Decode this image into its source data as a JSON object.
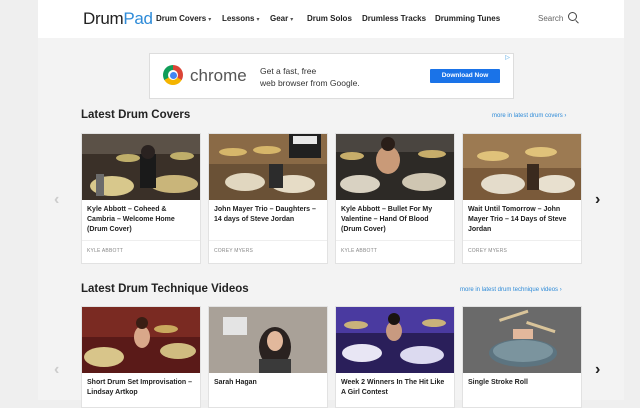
{
  "header": {
    "logo_drum": "Drum",
    "logo_pad": "Pad",
    "nav": [
      {
        "label": "Drum Covers",
        "has_dropdown": true
      },
      {
        "label": "Lessons",
        "has_dropdown": true
      },
      {
        "label": "Gear",
        "has_dropdown": true
      },
      {
        "label": "Drum Solos",
        "has_dropdown": false
      },
      {
        "label": "Drumless Tracks",
        "has_dropdown": false
      },
      {
        "label": "Drumming Tunes",
        "has_dropdown": false
      }
    ],
    "search_label": "Search",
    "search_icon": "search-icon"
  },
  "ad": {
    "brand": "chrome",
    "line1": "Get a fast, free",
    "line2": "web browser from Google.",
    "button": "Download Now"
  },
  "sections": [
    {
      "title": "Latest Drum Covers",
      "more": "more in latest drum covers ›",
      "cards": [
        {
          "title": "Kyle Abbott – Coheed & Cambria – Welcome Home (Drum Cover)",
          "author": "KYLE ABBOTT"
        },
        {
          "title": "John Mayer Trio – Daughters – 14 days of Steve Jordan",
          "author": "COREY MYERS"
        },
        {
          "title": "Kyle Abbott – Bullet For My Valentine – Hand Of Blood (Drum Cover)",
          "author": "KYLE ABBOTT"
        },
        {
          "title": "Wait Until Tomorrow – John Mayer Trio – 14 Days of Steve Jordan",
          "author": "COREY MYERS"
        }
      ]
    },
    {
      "title": "Latest Drum Technique Videos",
      "more": "more in latest drum technique videos ›",
      "cards": [
        {
          "title": "Short Drum Set Improvisation – Lindsay Artkop",
          "author": ""
        },
        {
          "title": "Sarah Hagan",
          "author": ""
        },
        {
          "title": "Week 2 Winners In The Hit Like A Girl Contest",
          "author": ""
        },
        {
          "title": "Single Stroke Roll",
          "author": ""
        }
      ]
    }
  ],
  "arrows": {
    "prev": "‹",
    "next": "›"
  },
  "colors": {
    "brand": "#2e8bd8",
    "ad_button": "#1a73e8"
  }
}
